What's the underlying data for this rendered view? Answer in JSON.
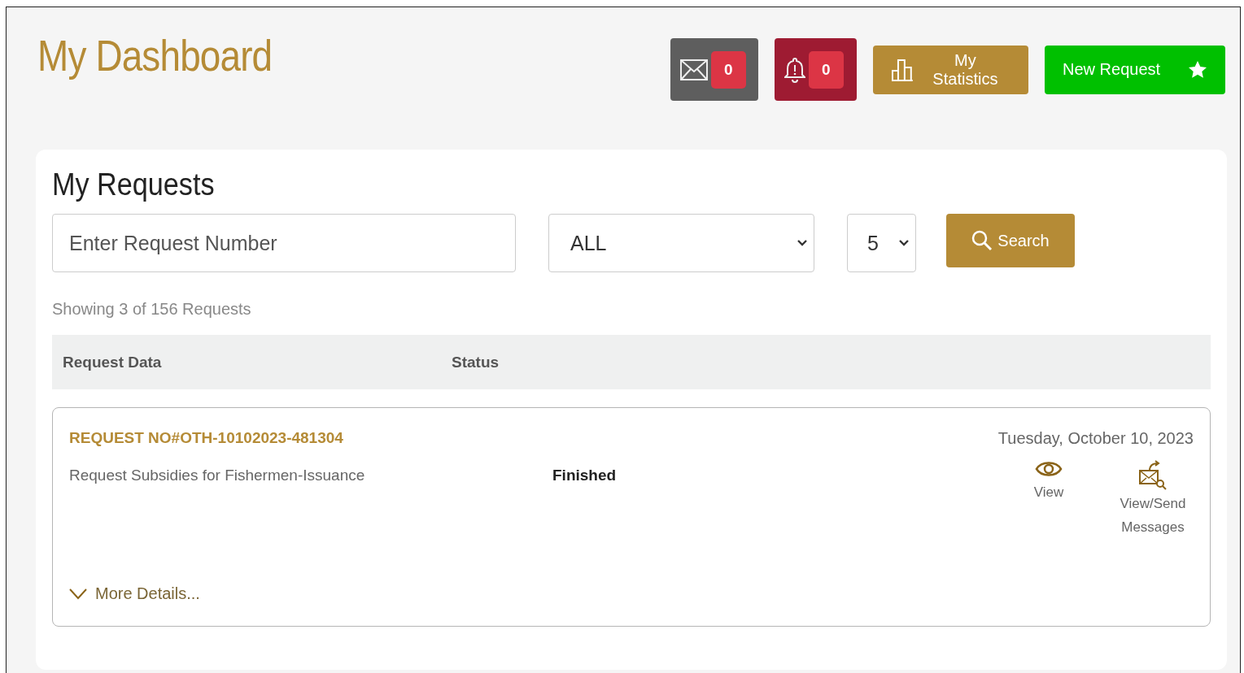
{
  "title": "My Dashboard",
  "header_buttons": [
    {
      "kind": "messages",
      "count": "0"
    },
    {
      "kind": "notifications",
      "count": "0"
    },
    {
      "kind": "statistics",
      "label": "My Statistics"
    },
    {
      "kind": "new",
      "label": "New Request"
    }
  ],
  "requests": {
    "title": "My Requests",
    "search": {
      "placeholder": "Enter Request Number"
    },
    "status_filter": "ALL",
    "page_size": "5",
    "search_button": "Search",
    "summary": "Showing 3 of 156 Requests",
    "columns": [
      "Request Data",
      "Status"
    ],
    "rows": [
      {
        "number": "REQUEST NO#OTH-10102023-481304",
        "service": "Request Subsidies for Fishermen-Issuance",
        "status": "Finished",
        "date": "Tuesday, October 10, 2023",
        "actions": [
          {
            "kind": "view",
            "label": "View"
          },
          {
            "kind": "messages",
            "label": "View/Send Messages"
          }
        ],
        "more": "More Details..."
      }
    ]
  }
}
